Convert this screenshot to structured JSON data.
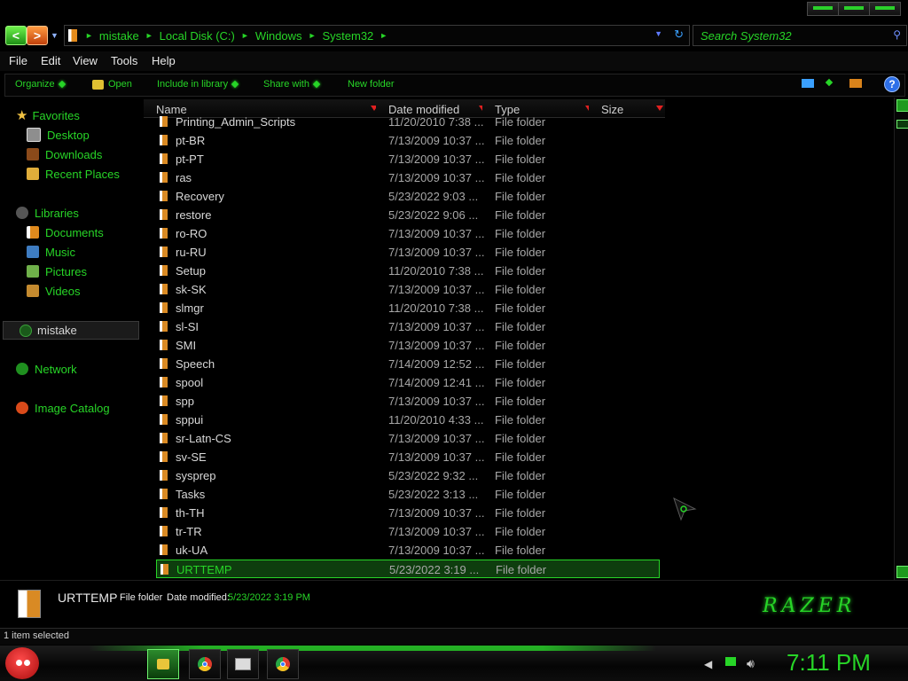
{
  "window": {
    "title_buttons": [
      "minimize",
      "maximize",
      "close"
    ]
  },
  "nav": {
    "back_glyph": "<",
    "forward_glyph": ">",
    "breadcrumbs": [
      "mistake",
      "Local Disk (C:)",
      "Windows",
      "System32"
    ],
    "search_placeholder": "Search System32"
  },
  "menu": [
    "File",
    "Edit",
    "View",
    "Tools",
    "Help"
  ],
  "toolbar": {
    "organize": "Organize",
    "open": "Open",
    "include_in_library": "Include in library",
    "share_with": "Share with",
    "new_folder": "New folder",
    "help_glyph": "?"
  },
  "sidebar": {
    "favorites": {
      "label": "Favorites",
      "items": [
        "Desktop",
        "Downloads",
        "Recent Places"
      ]
    },
    "libraries": {
      "label": "Libraries",
      "items": [
        "Documents",
        "Music",
        "Pictures",
        "Videos"
      ]
    },
    "homegroup": "mistake",
    "network": "Network",
    "image_catalog": "Image Catalog"
  },
  "columns": [
    "Name",
    "Date modified",
    "Type",
    "Size"
  ],
  "files": [
    {
      "name": "Printing_Admin_Scripts",
      "date": "11/20/2010 7:38 ...",
      "type": "File folder"
    },
    {
      "name": "pt-BR",
      "date": "7/13/2009 10:37 ...",
      "type": "File folder"
    },
    {
      "name": "pt-PT",
      "date": "7/13/2009 10:37 ...",
      "type": "File folder"
    },
    {
      "name": "ras",
      "date": "7/13/2009 10:37 ...",
      "type": "File folder"
    },
    {
      "name": "Recovery",
      "date": "5/23/2022 9:03 ...",
      "type": "File folder"
    },
    {
      "name": "restore",
      "date": "5/23/2022 9:06 ...",
      "type": "File folder"
    },
    {
      "name": "ro-RO",
      "date": "7/13/2009 10:37 ...",
      "type": "File folder"
    },
    {
      "name": "ru-RU",
      "date": "7/13/2009 10:37 ...",
      "type": "File folder"
    },
    {
      "name": "Setup",
      "date": "11/20/2010 7:38 ...",
      "type": "File folder"
    },
    {
      "name": "sk-SK",
      "date": "7/13/2009 10:37 ...",
      "type": "File folder"
    },
    {
      "name": "slmgr",
      "date": "11/20/2010 7:38 ...",
      "type": "File folder"
    },
    {
      "name": "sl-SI",
      "date": "7/13/2009 10:37 ...",
      "type": "File folder"
    },
    {
      "name": "SMI",
      "date": "7/13/2009 10:37 ...",
      "type": "File folder"
    },
    {
      "name": "Speech",
      "date": "7/14/2009 12:52 ...",
      "type": "File folder"
    },
    {
      "name": "spool",
      "date": "7/14/2009 12:41 ...",
      "type": "File folder"
    },
    {
      "name": "spp",
      "date": "7/13/2009 10:37 ...",
      "type": "File folder"
    },
    {
      "name": "sppui",
      "date": "11/20/2010 4:33 ...",
      "type": "File folder"
    },
    {
      "name": "sr-Latn-CS",
      "date": "7/13/2009 10:37 ...",
      "type": "File folder"
    },
    {
      "name": "sv-SE",
      "date": "7/13/2009 10:37 ...",
      "type": "File folder"
    },
    {
      "name": "sysprep",
      "date": "5/23/2022 9:32 ...",
      "type": "File folder"
    },
    {
      "name": "Tasks",
      "date": "5/23/2022 3:13 ...",
      "type": "File folder"
    },
    {
      "name": "th-TH",
      "date": "7/13/2009 10:37 ...",
      "type": "File folder"
    },
    {
      "name": "tr-TR",
      "date": "7/13/2009 10:37 ...",
      "type": "File folder"
    },
    {
      "name": "uk-UA",
      "date": "7/13/2009 10:37 ...",
      "type": "File folder"
    },
    {
      "name": "URTTEMP",
      "date": "5/23/2022 3:19 ...",
      "type": "File folder",
      "selected": true
    }
  ],
  "details": {
    "name": "URTTEMP",
    "type": "File folder",
    "date_label": "Date modified:",
    "date": "5/23/2022 3:19 PM",
    "logo": "RAZER"
  },
  "status": {
    "text": "1 item selected"
  },
  "taskbar": {
    "clock": "7:11 PM"
  },
  "colors": {
    "accent": "#27d527",
    "background": "#000000",
    "selection": "#0e3d0e"
  }
}
